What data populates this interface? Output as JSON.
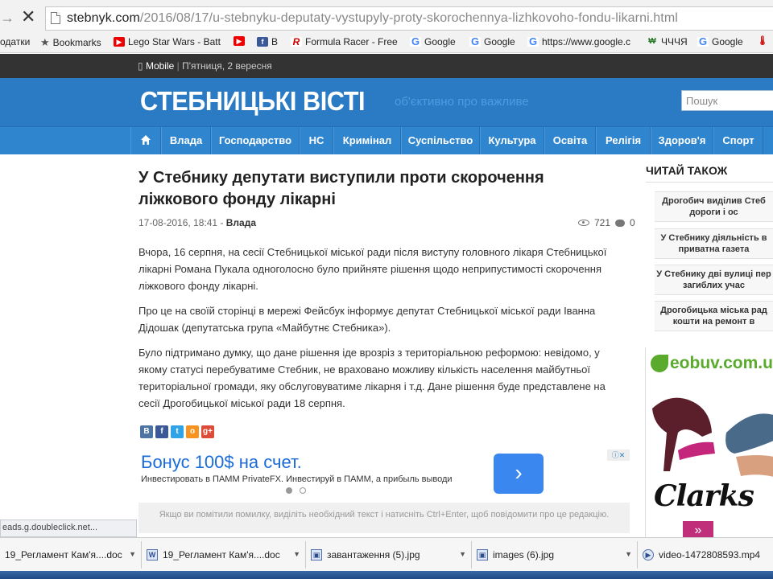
{
  "browser": {
    "url_domain": "stebnyk.com",
    "url_path": "/2016/08/17/u-stebnyku-deputaty-vystupyly-proty-skorochennya-lizhkovoho-fondu-likarni.html",
    "bookmarks": [
      {
        "label": "одатки",
        "icon": "none"
      },
      {
        "label": "Bookmarks",
        "icon": "star-icon"
      },
      {
        "label": "Lego Star Wars - Batt",
        "icon": "youtube-icon"
      },
      {
        "label": "",
        "icon": "youtube-icon"
      },
      {
        "label": "B",
        "icon": "facebook-icon"
      },
      {
        "label": "Formula Racer - Free",
        "icon": "formula-icon"
      },
      {
        "label": "Google",
        "icon": "google-icon"
      },
      {
        "label": "Google",
        "icon": "google-icon"
      },
      {
        "label": "https://www.google.c",
        "icon": "google-icon"
      },
      {
        "label": "ЧЧЧЯ",
        "icon": "ww-icon"
      },
      {
        "label": "Google",
        "icon": "google-icon"
      }
    ],
    "status_text": "eads.g.doubleclick.net..."
  },
  "site": {
    "mobile_label": "Mobile",
    "date": "П'ятниця, 2 вересня",
    "logo": "СТЕБНИЦЬКІ ВІСТІ",
    "slogan": "об'єктивно про важливе",
    "search_placeholder": "Пошук",
    "nav": [
      "Влада",
      "Господарство",
      "НС",
      "Кримінал",
      "Суспільство",
      "Культура",
      "Освіта",
      "Релігія",
      "Здоров'я",
      "Спорт"
    ]
  },
  "article": {
    "title": "У Стебнику депутати виступили проти скорочення ліжкового фонду лікарні",
    "date": "17-08-2016, 18:41",
    "category": "Влада",
    "meta_sep": " - ",
    "views": "721",
    "comments": "0",
    "paragraphs": [
      "Вчора, 16 серпня, на сесії Стебницької міської ради після виступу головного лікаря Стебницької лікарні Романа Пукала одноголосно було прийняте рішення щодо неприпустимості скорочення ліжкового фонду лікарні.",
      "Про це на своїй сторінці в мережі Фейсбук інформує депутат Стебницької міської ради Іванна Дідошак (депутатська група «Майбутнє Стебника»).",
      "Було підтримано думку, що дане рішення іде врозріз з територіальною реформою: невідомо, у якому статусі перебуватиме Стебник, не враховано можливу кількість населення майбутньої територіальної громади, яку обслуговуватиме лікарня і т.д. Дане рішення буде представлене на сесії Дрогобицької міської ради 18 серпня."
    ],
    "share": [
      "В",
      "f",
      "t",
      "о",
      "g+"
    ],
    "notice": "Якщо ви помітили помилку, виділіть необхідний текст і натисніть Ctrl+Enter, щоб повідомити про це редакцію."
  },
  "ad": {
    "title": "Бонус 100$ на счет.",
    "subtitle": "Инвестировать в ПАММ PrivateFX. Инвестируй в ПАММ, а прибыль выводи",
    "button": "›"
  },
  "sidebar": {
    "title": "ЧИТАЙ ТАКОЖ",
    "items": [
      {
        "line1": "Дрогобич виділив Стеб",
        "line2": "дороги і ос"
      },
      {
        "line1": "У Стебнику діяльність в",
        "line2": "приватна газета"
      },
      {
        "line1": "У Стебнику дві вулиці пер",
        "line2": "загиблих учас"
      },
      {
        "line1": "Дрогобицька міська рад",
        "line2": "кошти на ремонт в"
      }
    ],
    "ad_brand": "eobuv.com.u",
    "ad_brand2": "Clarks",
    "ad_more": "»"
  },
  "downloads": [
    {
      "name": "19_Регламент Кам'я....doc",
      "icon": "doc-icon"
    },
    {
      "name": "19_Регламент Кам'я....doc",
      "icon": "word-icon"
    },
    {
      "name": "завантаження (5).jpg",
      "icon": "image-icon"
    },
    {
      "name": "images (6).jpg",
      "icon": "image-icon"
    },
    {
      "name": "video-1472808593.mp4",
      "icon": "video-icon"
    }
  ],
  "colors": {
    "header_blue": "#2b7bc4",
    "nav_blue": "#2f86cf",
    "topbar": "#333333",
    "ad_blue": "#1a6bd8"
  }
}
